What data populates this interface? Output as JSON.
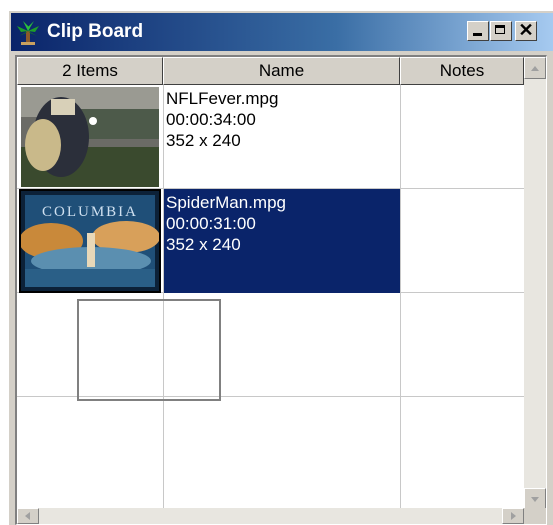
{
  "window": {
    "title": "Clip Board",
    "icon": "palm-tree-icon",
    "controls": {
      "minimize": "minimize-icon",
      "maximize": "maximize-icon",
      "close": "✕"
    }
  },
  "list": {
    "columns": [
      "2 Items",
      "Name",
      "Notes"
    ],
    "items": [
      {
        "name": "NFLFever.mpg",
        "duration": "00:00:34:00",
        "size": "352 x 240",
        "notes": "",
        "selected": false,
        "thumbnail": "football-player-thumbnail"
      },
      {
        "name": "SpiderMan.mpg",
        "duration": "00:00:31:00",
        "size": "352 x 240",
        "notes": "",
        "selected": true,
        "thumbnail": "columbia-logo-thumbnail"
      }
    ]
  },
  "colors": {
    "selection": "#0a246a",
    "titlebar_start": "#0a246a",
    "titlebar_end": "#a6caf0",
    "face": "#d4d0c8"
  }
}
